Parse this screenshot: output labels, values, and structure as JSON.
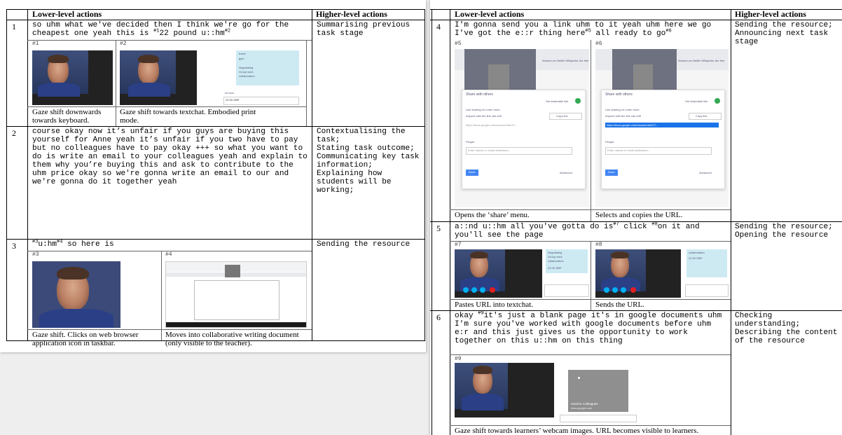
{
  "headers": {
    "lower": "Lower-level actions",
    "higher": "Higher-level actions"
  },
  "rows": [
    {
      "num": "1",
      "text_html": "so uhm what we've decided then I think we're go for the cheapest one yeah this is <sup>#1</sup>22 pound u::hm<sup>#2</sup>",
      "higher": "Summarising previous task stage",
      "images": [
        {
          "label": "#1",
          "caption": "Gaze shift downwards towards keyboard.",
          "panel_items": []
        },
        {
          "label": "#2",
          "caption": "Gaze shift towards textchat. Embodied print mode.",
          "panel_items": [
            "travel",
            "gym",
            "Negotiating",
            "Group work",
            "collaboration"
          ],
          "chat_name": "ed foon",
          "chat_text": "22.00 GBP"
        }
      ]
    },
    {
      "num": "2",
      "text_html": "course okay now it’s unfair if you guys are buying this yourself for Anne yeah it’s unfair if you two have to pay but no colleagues have to pay okay +++ so what you want to do is write an email to your colleagues yeah and explain to them why you’re buying this and ask to contribute to the uhm price okay so we're gonna write an email to our and we're gonna do it together yeah",
      "higher": "Contextualising the task;\nStating task outcome;\nCommunicating key task information;\nExplaining how students will be working;",
      "images": []
    },
    {
      "num": "3",
      "text_html": "<sup>#3</sup>u:hm<sup>#4</sup> so here is",
      "higher": "Sending the resource",
      "images": [
        {
          "label": "#3",
          "caption": "Gaze shift. Clicks on web browser application icon in taskbar."
        },
        {
          "label": "#4",
          "caption": "Moves into collaborative writing document (only visible to the teacher)."
        }
      ]
    },
    {
      "num": "4",
      "text_html": "I'm gonna send you a link uhm to it yeah uhm here we go I've got the e::r thing here<sup>#5</sup> all ready to go<sup>#6</sup>",
      "higher": "Sending the resource;\nAnnouncing next task stage",
      "images": [
        {
          "label": "#5",
          "caption": "Opens the ‘share’ menu.",
          "dialog": {
            "title": "Share with others",
            "link_label": "Get shareable link",
            "sharing": "Link sharing on  Learn more",
            "access": "Anyone with the link can edit",
            "copy": "Copy link",
            "url": "https://docs.google.com/document/d/1Y...",
            "people": "People",
            "placeholder": "Enter names or email addresses...",
            "done": "Done",
            "advanced": "Advanced",
            "bookmarks": "Amazon.es   Netflix   Wikipedia, the free"
          }
        },
        {
          "label": "#6",
          "caption": "Selects and copies the URL.",
          "dialog": {
            "title": "Share with others",
            "link_label": "Get shareable link",
            "sharing": "Link sharing on  Learn more",
            "access": "Anyone with the link can edit",
            "copy": "Copy link",
            "url": "https://docs.google.com/document/d/1Y...",
            "people": "People",
            "placeholder": "Enter names or email addresses...",
            "done": "Done",
            "advanced": "Advanced",
            "bookmarks": "Amazon.es   Netflix   Wikipedia, the free"
          }
        }
      ]
    },
    {
      "num": "5",
      "text_html": "a::nd u::hm all you've gotta do is<sup>#7</sup> click <sup>#8</sup>on it and you'll see the page",
      "higher": "Sending the resource;\nOpening the resource",
      "images": [
        {
          "label": "#7",
          "caption": "Pastes URL into textchat.",
          "panel_items": [
            "Negotiating",
            "Group work",
            "collaboration",
            "22.00 GBP"
          ]
        },
        {
          "label": "#8",
          "caption": "Sends the URL.",
          "panel_items": [
            "collaboration",
            "22.00 GBP"
          ]
        }
      ]
    },
    {
      "num": "6",
      "text_html": "okay <sup>#9</sup>it's just a blank page it's in google documents uhm I'm sure you've worked with google documents before uhm e:r and this just gives us the opportunity to work together on this u::hm on this thing",
      "higher": "Checking understanding;\nDescribing the content of the resource",
      "images": [
        {
          "label": "#9",
          "caption": "Gaze shift towards learners’ webcam images. URL becomes visible to learners.",
          "preview_title": "email to colleagues",
          "preview_url": "docs.google.com"
        }
      ]
    }
  ]
}
